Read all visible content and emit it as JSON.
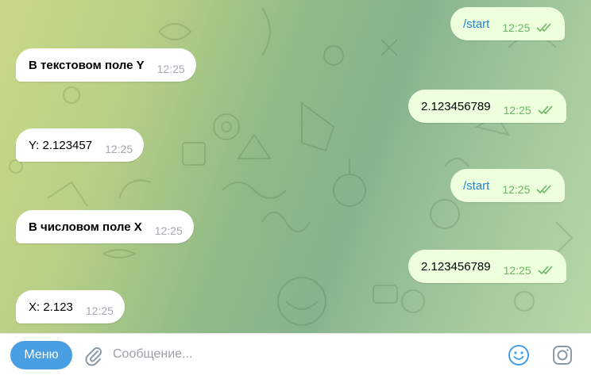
{
  "messages": [
    {
      "direction": "out",
      "text": "/start",
      "time": "12:25",
      "read": true
    },
    {
      "direction": "in",
      "text": "В текстовом поле Y",
      "time": "12:25"
    },
    {
      "direction": "out",
      "text": "2.123456789",
      "time": "12:25",
      "read": true
    },
    {
      "direction": "in",
      "text": "Y: 2.123457",
      "time": "12:25"
    },
    {
      "direction": "out",
      "text": "/start",
      "time": "12:25",
      "read": true
    },
    {
      "direction": "in",
      "text": "В числовом поле X",
      "time": "12:25"
    },
    {
      "direction": "out",
      "text": "2.123456789",
      "time": "12:25",
      "read": true
    },
    {
      "direction": "in",
      "text": "X: 2.123",
      "time": "12:25"
    }
  ],
  "composer": {
    "menu_label": "Меню",
    "placeholder": "Сообщение...",
    "value": ""
  },
  "icons": {
    "attach": "paperclip-icon",
    "emoji": "emoji-icon",
    "camera": "camera-icon",
    "read_status": "double-check-icon"
  },
  "colors": {
    "incoming_bubble": "#ffffff",
    "outgoing_bubble": "#eeffde",
    "time_outgoing": "#6bb662",
    "time_incoming": "#a3a9b0",
    "command_link": "#2a82c7",
    "menu_button": "#4a9fe3",
    "composer_icons": "#8a9aa8"
  }
}
